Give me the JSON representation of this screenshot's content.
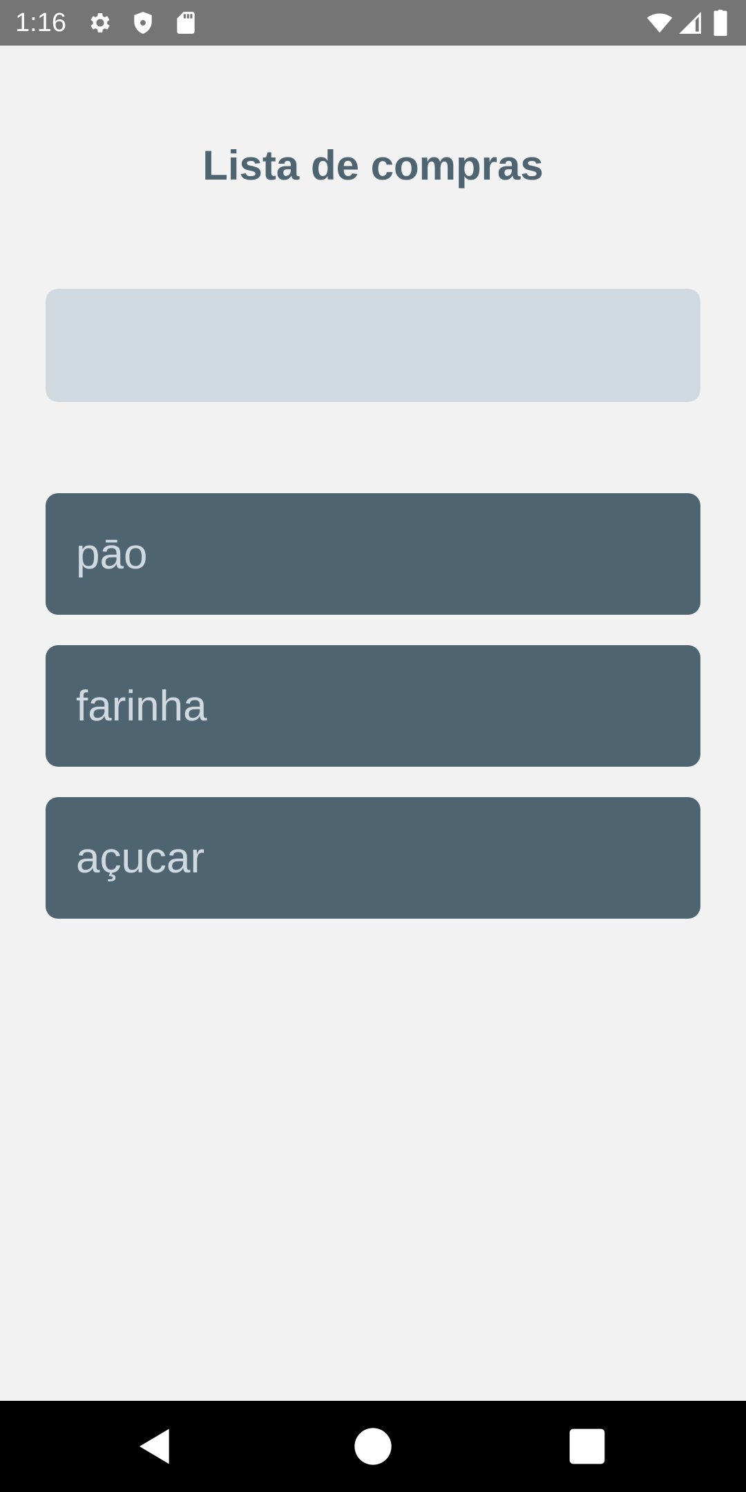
{
  "status_bar": {
    "time": "1:16",
    "left_icons": [
      "gear-icon",
      "shield-icon",
      "sd-card-icon"
    ],
    "right_icons": [
      "wifi-icon",
      "cell-signal-icon",
      "battery-icon"
    ]
  },
  "app": {
    "title": "Lista de compras",
    "input": {
      "value": "",
      "placeholder": ""
    },
    "items": [
      {
        "label": "pāo"
      },
      {
        "label": "farinha"
      },
      {
        "label": "açucar"
      }
    ],
    "colors": {
      "background": "#f2f2f2",
      "accent": "#4e6470",
      "input_bg": "#d0d9df",
      "item_text": "#d0d9df"
    }
  },
  "nav_bar": {
    "buttons": [
      "back-icon",
      "home-icon",
      "recents-icon"
    ]
  }
}
